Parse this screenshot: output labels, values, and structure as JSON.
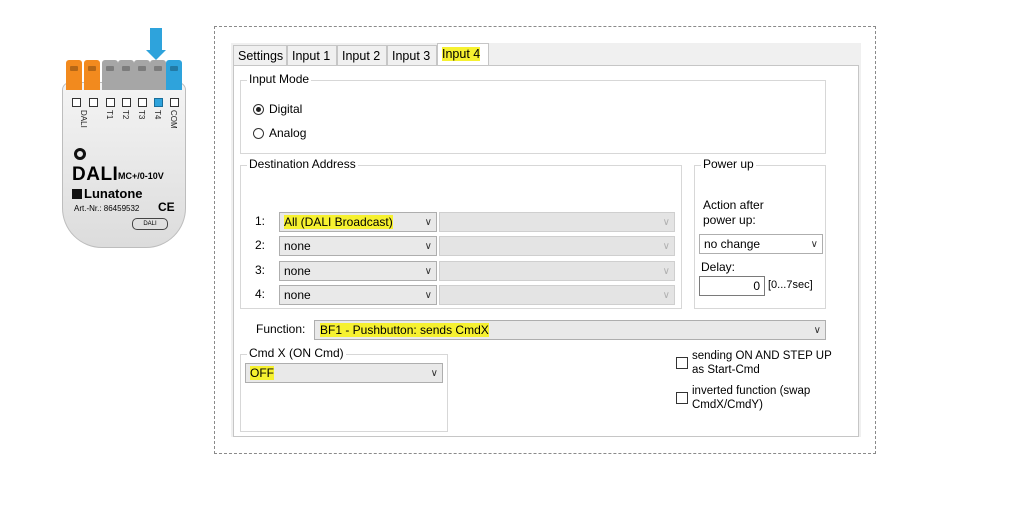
{
  "device": {
    "top_labels": [
      "DALI",
      "T1",
      "T2",
      "T3",
      "T4",
      "COM"
    ],
    "brand_dali": "DALI",
    "model": "MC+/0-10V",
    "brand": "Lunatone",
    "article": "Art.-Nr.: 86459532",
    "ce_mark": "CE",
    "dali_badge": "DALI",
    "colors": {
      "orange": "#f28a1e",
      "blue": "#2ea3dc",
      "grey": "#a6a6a6"
    }
  },
  "tabs": [
    "Settings",
    "Input 1",
    "Input 2",
    "Input 3",
    "Input 4"
  ],
  "active_tab": "Input 4",
  "input_mode": {
    "title": "Input Mode",
    "options": [
      "Digital",
      "Analog"
    ],
    "selected": "Digital"
  },
  "destination": {
    "title": "Destination Address",
    "rows": [
      {
        "label": "1:",
        "value": "All (DALI Broadcast)"
      },
      {
        "label": "2:",
        "value": "none"
      },
      {
        "label": "3:",
        "value": "none"
      },
      {
        "label": "4:",
        "value": "none"
      }
    ]
  },
  "power_up": {
    "title": "Power up",
    "action_label": "Action after power up:",
    "action_value": "no change",
    "delay_label": "Delay:",
    "delay_value": "0",
    "delay_range": "[0...7sec]"
  },
  "function": {
    "label": "Function:",
    "value": "BF1 - Pushbutton:  sends CmdX"
  },
  "cmdx": {
    "title": "Cmd X  (ON Cmd)",
    "value": "OFF"
  },
  "options": {
    "sending_on": "sending ON AND STEP UP as Start-Cmd",
    "inverted": "inverted function (swap CmdX/CmdY)"
  },
  "highlight_color": "#f6f130"
}
